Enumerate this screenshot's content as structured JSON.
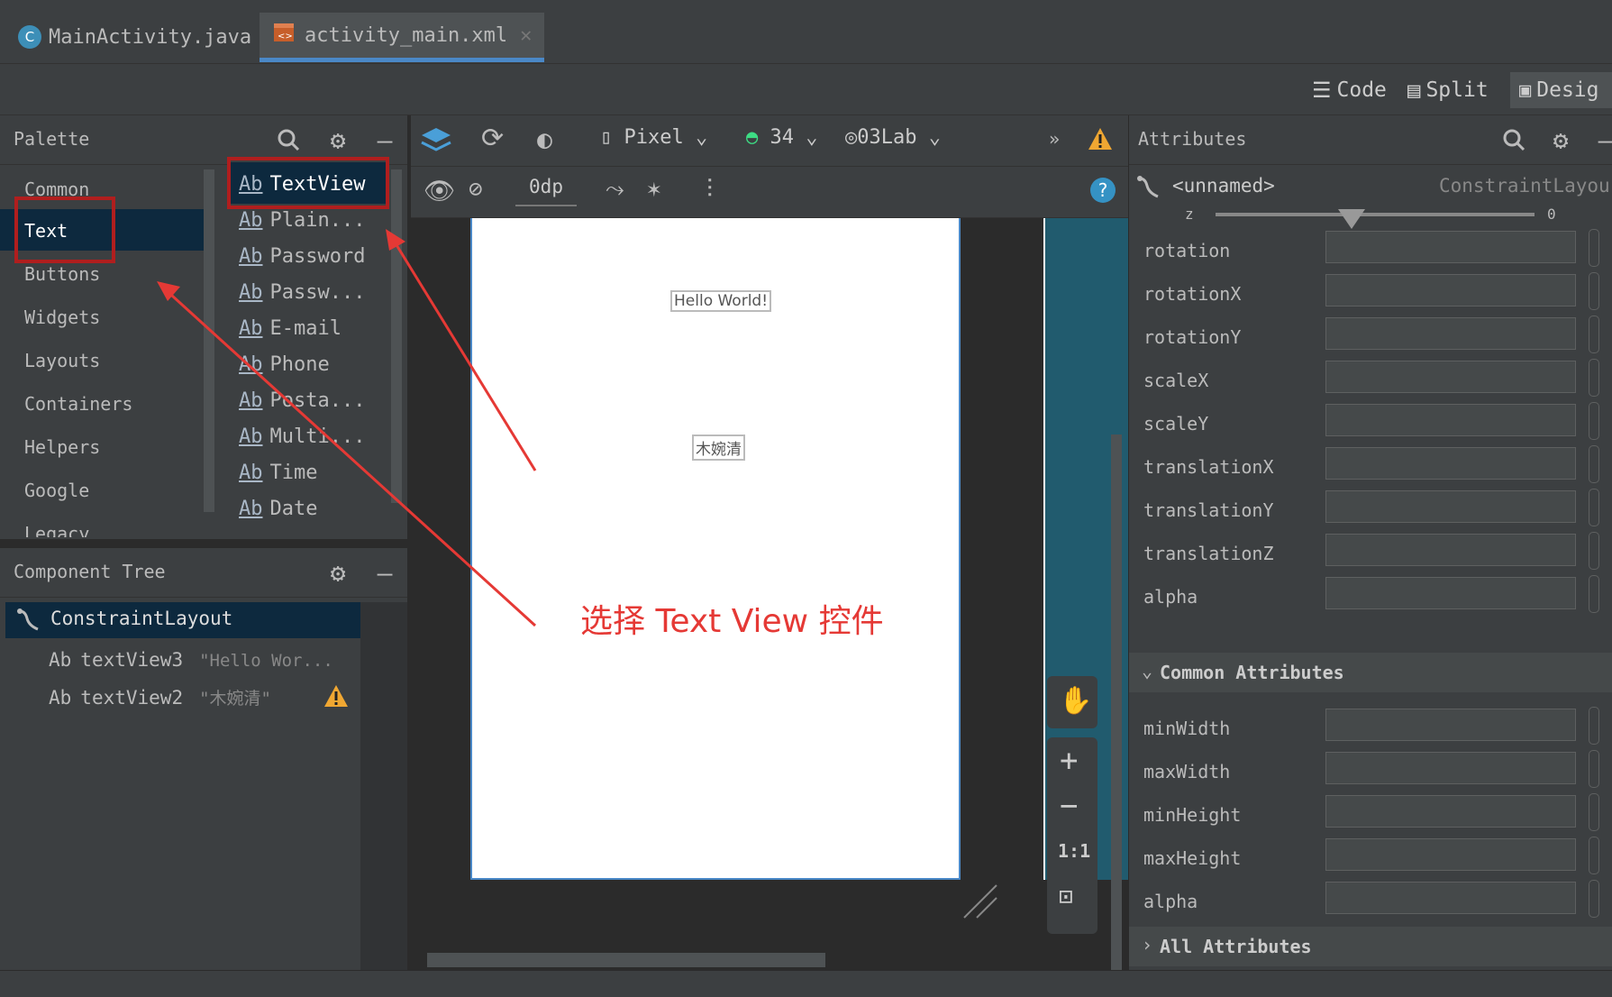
{
  "tabs": [
    {
      "label": "MainActivity.java",
      "icon": "java-class-icon"
    },
    {
      "label": "activity_main.xml",
      "icon": "layout-xml-icon"
    }
  ],
  "view_modes": {
    "code": "Code",
    "split": "Split",
    "design": "Desig"
  },
  "palette": {
    "title": "Palette",
    "categories": [
      "Common",
      "Text",
      "Buttons",
      "Widgets",
      "Layouts",
      "Containers",
      "Helpers",
      "Google",
      "Legacy"
    ],
    "selected_category": "Text",
    "items": [
      "TextView",
      "Plain...",
      "Password",
      "Passw...",
      "E-mail",
      "Phone",
      "Posta...",
      "Multi...",
      "Time",
      "Date"
    ],
    "item_prefix": "Ab"
  },
  "component_tree": {
    "title": "Component Tree",
    "root": "ConstraintLayout",
    "children": [
      {
        "prefix": "Ab",
        "id": "textView3",
        "text": "\"Hello Wor...",
        "warning": false
      },
      {
        "prefix": "Ab",
        "id": "textView2",
        "text": "\"木婉清\"",
        "warning": true
      }
    ]
  },
  "design_toolbar": {
    "device": "Pixel",
    "api": "34",
    "theme": "03Lab",
    "margin": "0dp"
  },
  "preview": {
    "text1": "Hello World!",
    "text2": "木婉清"
  },
  "annotation": "选择 Text View 控件",
  "zoom_controls": {
    "one_to_one": "1:1"
  },
  "attributes": {
    "title": "Attributes",
    "component_name": "<unnamed>",
    "component_type": "ConstraintLayou",
    "z_label": "z",
    "z_value": "0",
    "transform_rows": [
      "rotation",
      "rotationX",
      "rotationY",
      "scaleX",
      "scaleY",
      "translationX",
      "translationY",
      "translationZ",
      "alpha"
    ],
    "common_header": "Common Attributes",
    "common_rows": [
      "minWidth",
      "maxWidth",
      "minHeight",
      "maxHeight",
      "alpha"
    ],
    "all_header": "All Attributes"
  },
  "colors": {
    "accent": "#4a88c7",
    "annotation_red": "#e53935",
    "warning": "#f0a732",
    "selection": "#0d293e"
  }
}
